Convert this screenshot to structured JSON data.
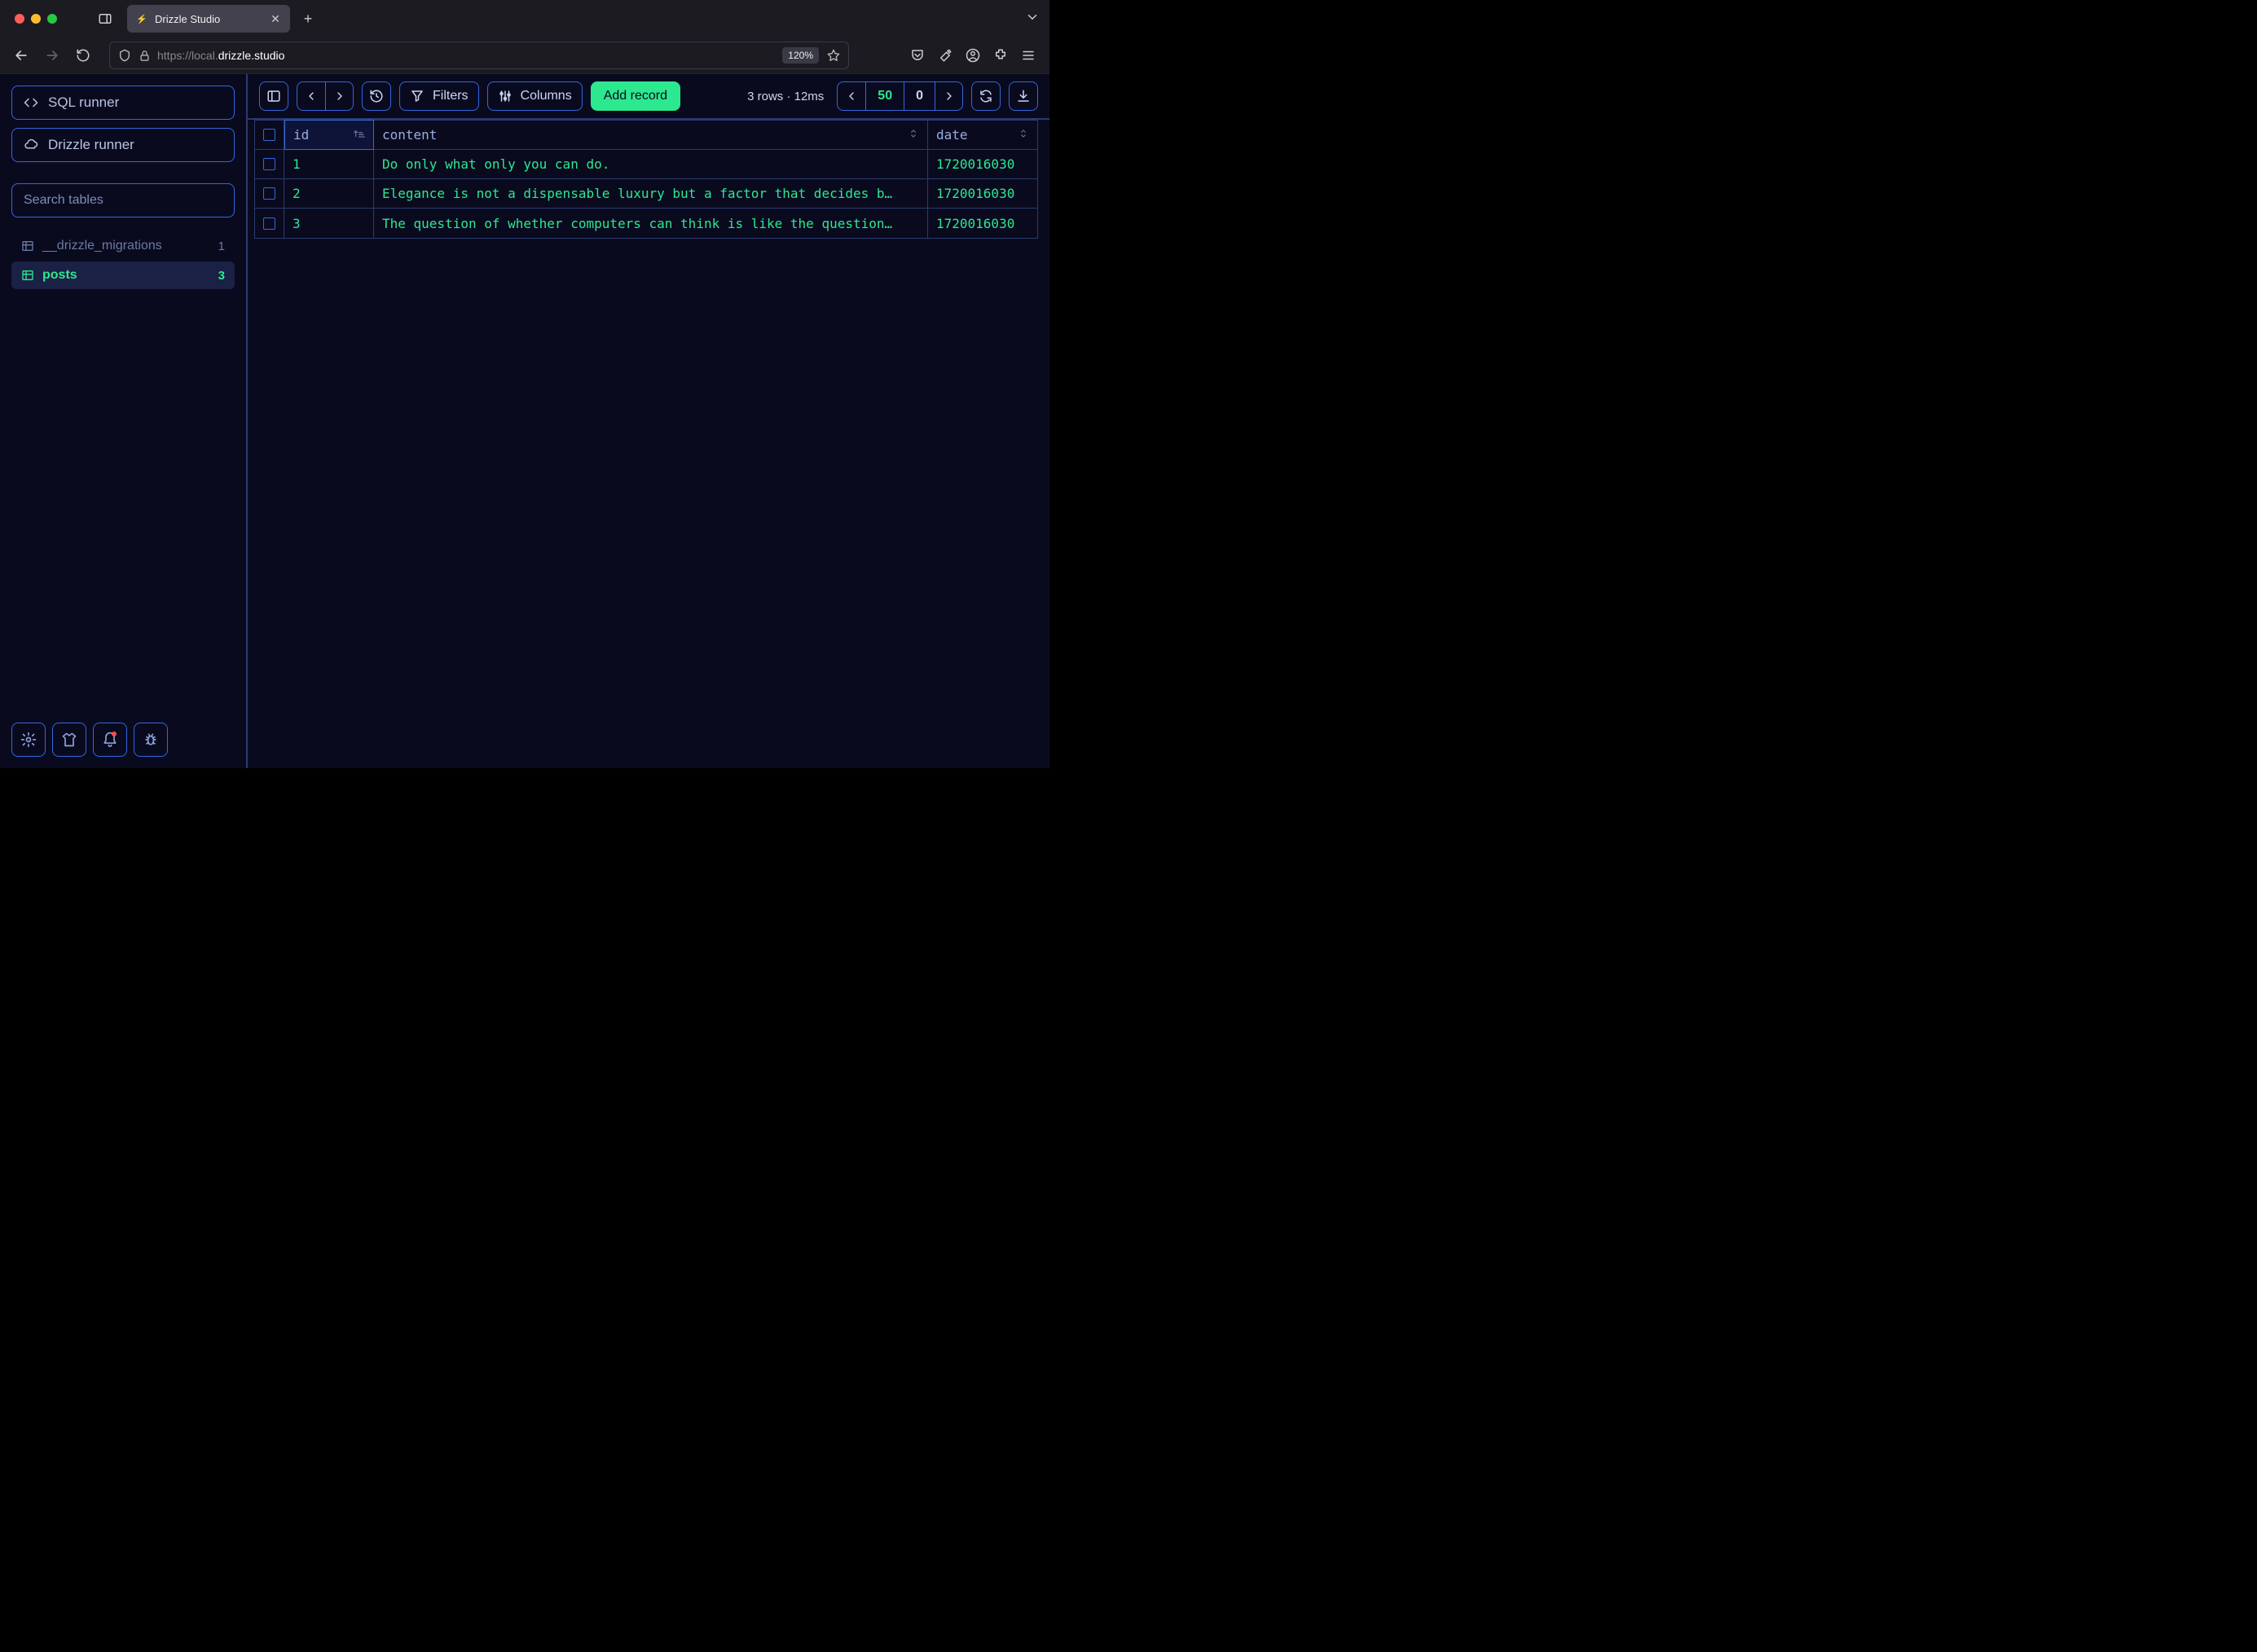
{
  "browser": {
    "tab_title": "Drizzle Studio",
    "url_prefix": "https://local.",
    "url_domain": "drizzle.studio",
    "zoom": "120%"
  },
  "sidebar": {
    "sql_runner": "SQL runner",
    "drizzle_runner": "Drizzle runner",
    "search_placeholder": "Search tables",
    "tables": [
      {
        "name": "__drizzle_migrations",
        "count": "1",
        "active": false
      },
      {
        "name": "posts",
        "count": "3",
        "active": true
      }
    ]
  },
  "toolbar": {
    "filters": "Filters",
    "columns": "Columns",
    "add_record": "Add record",
    "stats": "3 rows · 12ms",
    "page_size": "50",
    "page_offset": "0"
  },
  "table": {
    "headers": {
      "id": "id",
      "content": "content",
      "date": "date"
    },
    "rows": [
      {
        "id": "1",
        "content": "Do only what only you can do.",
        "date": "1720016030"
      },
      {
        "id": "2",
        "content": "Elegance is not a dispensable luxury but a factor that decides b…",
        "date": "1720016030"
      },
      {
        "id": "3",
        "content": "The question of whether computers can think is like the question…",
        "date": "1720016030"
      }
    ]
  }
}
